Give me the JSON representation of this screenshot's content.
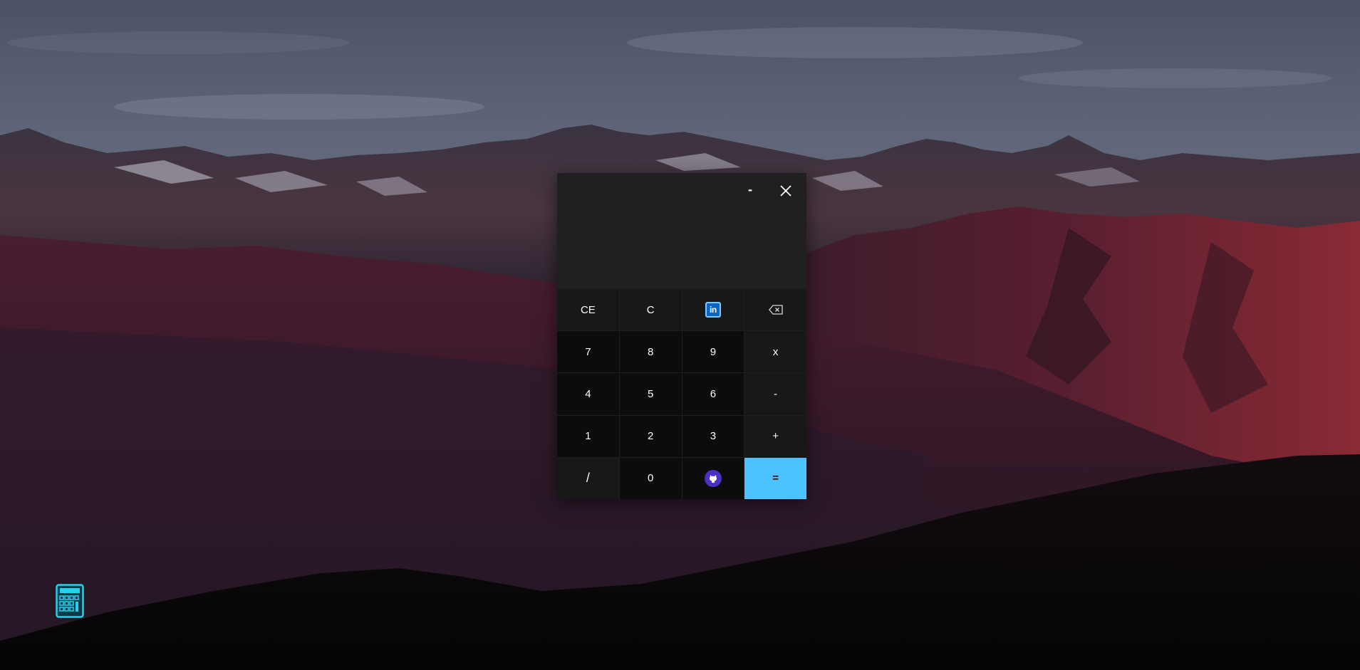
{
  "desktop": {
    "wallpaper": "mountain-range-at-dusk",
    "icons": [
      {
        "name": "calculator-icon",
        "color": "#18c8e8"
      }
    ]
  },
  "calculator": {
    "display": {
      "value": ""
    },
    "window_controls": {
      "minimize": "-",
      "close": "close-icon"
    },
    "keys": [
      {
        "label": "CE",
        "kind": "fn"
      },
      {
        "label": "C",
        "kind": "fn"
      },
      {
        "label": "linkedin-icon",
        "kind": "icon"
      },
      {
        "label": "backspace-icon",
        "kind": "icon"
      },
      {
        "label": "7",
        "kind": "num"
      },
      {
        "label": "8",
        "kind": "num"
      },
      {
        "label": "9",
        "kind": "num"
      },
      {
        "label": "x",
        "kind": "op"
      },
      {
        "label": "4",
        "kind": "num"
      },
      {
        "label": "5",
        "kind": "num"
      },
      {
        "label": "6",
        "kind": "num"
      },
      {
        "label": "-",
        "kind": "op"
      },
      {
        "label": "1",
        "kind": "num"
      },
      {
        "label": "2",
        "kind": "num"
      },
      {
        "label": "3",
        "kind": "num"
      },
      {
        "label": "+",
        "kind": "op"
      },
      {
        "label": "/",
        "kind": "op"
      },
      {
        "label": "0",
        "kind": "num"
      },
      {
        "label": "github-icon",
        "kind": "icon"
      },
      {
        "label": "=",
        "kind": "eq"
      }
    ],
    "accent_color": "#4cc2ff",
    "linkedin_text": "in"
  }
}
